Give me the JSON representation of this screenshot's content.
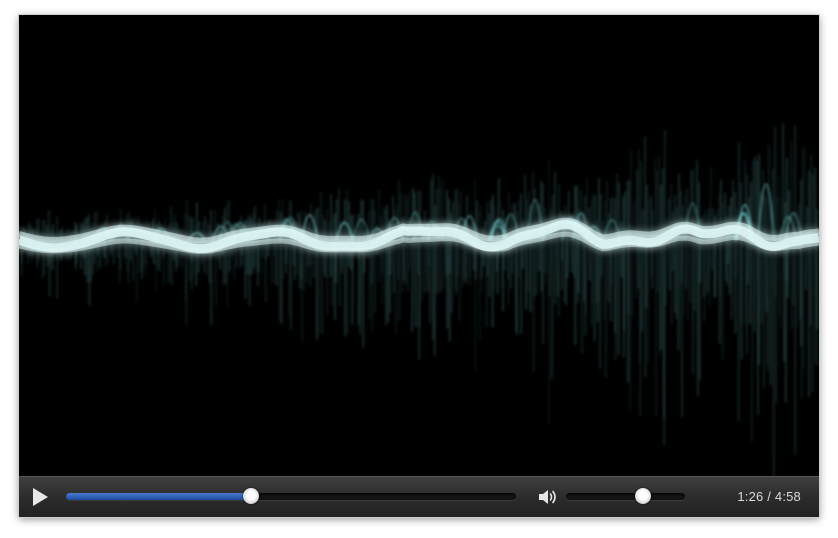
{
  "player": {
    "current_time": "1:26",
    "duration": "4:58",
    "time_separator": " / ",
    "progress_fraction": 0.41,
    "volume_fraction": 0.65,
    "accent_color": "#2f62c4",
    "waveform_color": "#7fe3e3"
  },
  "icons": {
    "play": "play-icon",
    "volume": "speaker-icon"
  }
}
